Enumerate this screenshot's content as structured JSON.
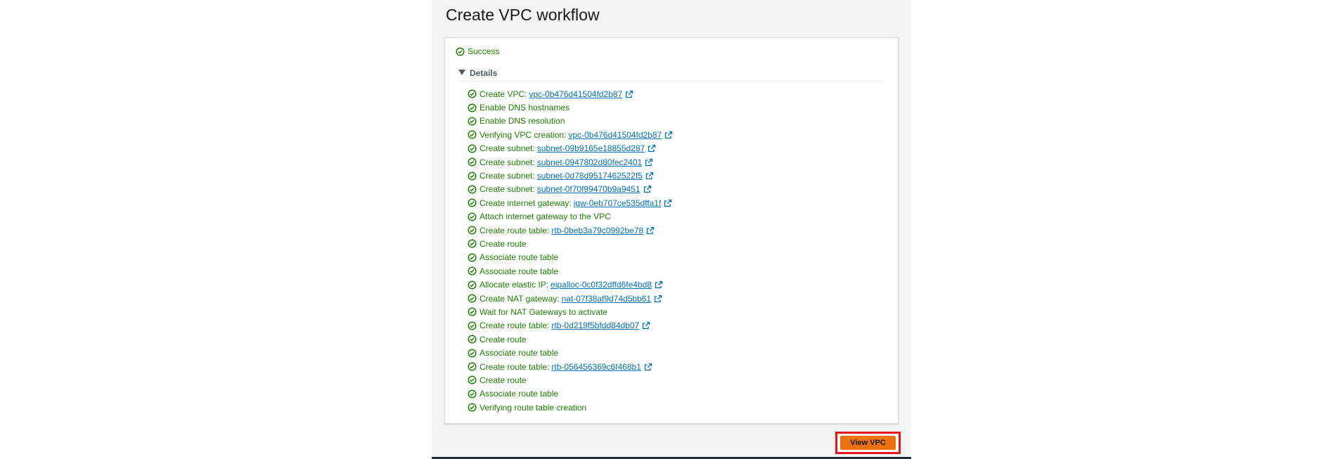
{
  "page": {
    "title": "Create VPC workflow"
  },
  "status": {
    "label": "Success"
  },
  "details": {
    "label": "Details"
  },
  "steps": [
    {
      "text": "Create VPC:",
      "link": "vpc-0b476d41504fd2b87"
    },
    {
      "text": "Enable DNS hostnames",
      "link": null
    },
    {
      "text": "Enable DNS resolution",
      "link": null
    },
    {
      "text": "Verifying VPC creation:",
      "link": "vpc-0b476d41504fd2b87"
    },
    {
      "text": "Create subnet:",
      "link": "subnet-09b9165e18855d287"
    },
    {
      "text": "Create subnet:",
      "link": "subnet-0947802d80fec2401"
    },
    {
      "text": "Create subnet:",
      "link": "subnet-0d78d9517462522f5"
    },
    {
      "text": "Create subnet:",
      "link": "subnet-0f70f99470b9a9451"
    },
    {
      "text": "Create internet gateway:",
      "link": "igw-0eb707ce535dffa1f"
    },
    {
      "text": "Attach internet gateway to the VPC",
      "link": null
    },
    {
      "text": "Create route table:",
      "link": "rtb-0beb3a79c0992be78"
    },
    {
      "text": "Create route",
      "link": null
    },
    {
      "text": "Associate route table",
      "link": null
    },
    {
      "text": "Associate route table",
      "link": null
    },
    {
      "text": "Allocate elastic IP:",
      "link": "eipalloc-0c0f32dffd6fe4bd8"
    },
    {
      "text": "Create NAT gateway:",
      "link": "nat-07f38af9d74d5bb61"
    },
    {
      "text": "Wait for NAT Gateways to activate",
      "link": null
    },
    {
      "text": "Create route table:",
      "link": "rtb-0d219f5bfdd84db07"
    },
    {
      "text": "Create route",
      "link": null
    },
    {
      "text": "Associate route table",
      "link": null
    },
    {
      "text": "Create route table:",
      "link": "rtb-056456369c6f468b1"
    },
    {
      "text": "Create route",
      "link": null
    },
    {
      "text": "Associate route table",
      "link": null
    },
    {
      "text": "Verifying route table creation",
      "link": null
    }
  ],
  "icons": {
    "step": "check-circle-icon",
    "link": "external-link-icon",
    "details": "caret-down-icon"
  },
  "actions": {
    "view_vpc_label": "View VPC"
  },
  "colors": {
    "success": "#1d8102",
    "link": "#0073bb",
    "primary_button": "#ec7211",
    "highlight_frame": "#e5161b",
    "page_background": "#f2f3f3"
  }
}
